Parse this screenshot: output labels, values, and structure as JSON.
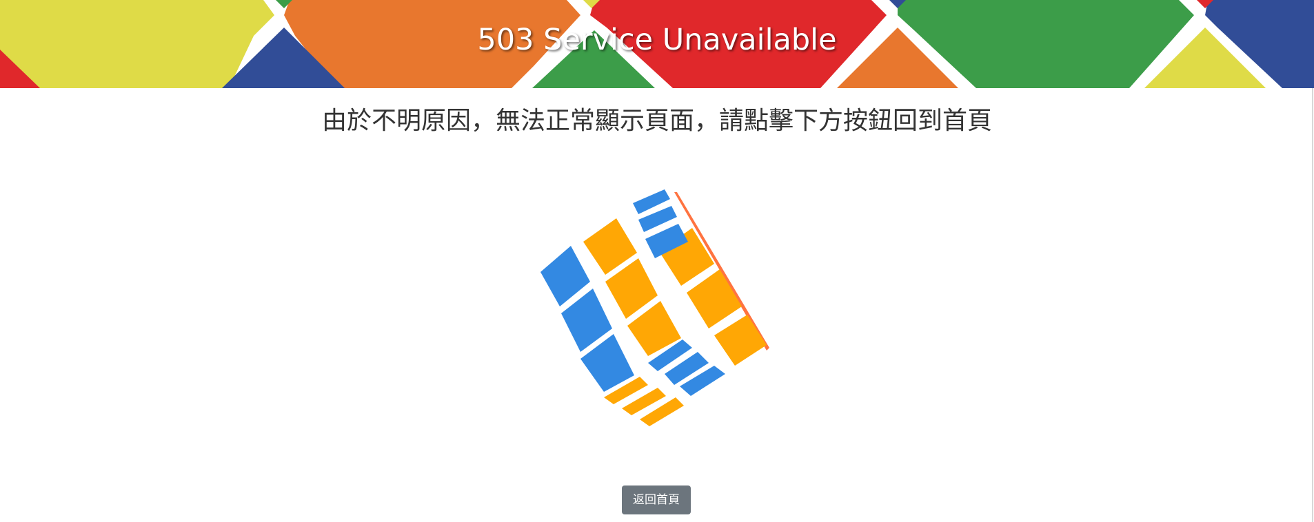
{
  "header": {
    "title": "503 Service Unavailable",
    "colors": {
      "yellow": "#dfdb47",
      "orange": "#e8772e",
      "red": "#e0282b",
      "green": "#3c9d49",
      "blue": "#314d97",
      "gap": "#ffffff"
    }
  },
  "main": {
    "message": "由於不明原因，無法正常顯示頁面，請點擊下方按鈕回到首頁",
    "cube_colors": {
      "blue": "#3389e2",
      "orange": "#ffa705",
      "edge": "#ff5a1f"
    }
  },
  "actions": {
    "home_label": "返回首頁"
  }
}
